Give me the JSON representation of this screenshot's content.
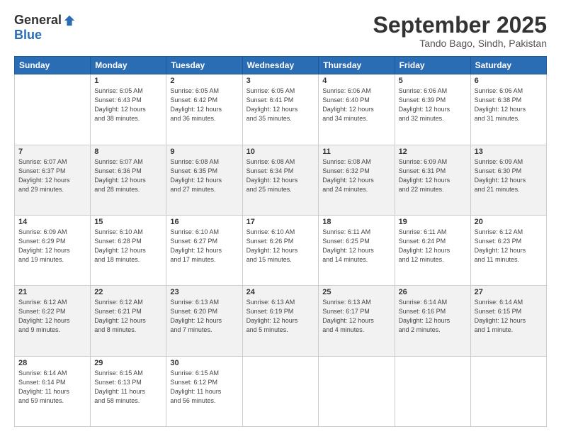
{
  "header": {
    "logo_general": "General",
    "logo_blue": "Blue",
    "month_title": "September 2025",
    "location": "Tando Bago, Sindh, Pakistan"
  },
  "columns": [
    "Sunday",
    "Monday",
    "Tuesday",
    "Wednesday",
    "Thursday",
    "Friday",
    "Saturday"
  ],
  "weeks": [
    [
      {
        "day": "",
        "info": ""
      },
      {
        "day": "1",
        "info": "Sunrise: 6:05 AM\nSunset: 6:43 PM\nDaylight: 12 hours\nand 38 minutes."
      },
      {
        "day": "2",
        "info": "Sunrise: 6:05 AM\nSunset: 6:42 PM\nDaylight: 12 hours\nand 36 minutes."
      },
      {
        "day": "3",
        "info": "Sunrise: 6:05 AM\nSunset: 6:41 PM\nDaylight: 12 hours\nand 35 minutes."
      },
      {
        "day": "4",
        "info": "Sunrise: 6:06 AM\nSunset: 6:40 PM\nDaylight: 12 hours\nand 34 minutes."
      },
      {
        "day": "5",
        "info": "Sunrise: 6:06 AM\nSunset: 6:39 PM\nDaylight: 12 hours\nand 32 minutes."
      },
      {
        "day": "6",
        "info": "Sunrise: 6:06 AM\nSunset: 6:38 PM\nDaylight: 12 hours\nand 31 minutes."
      }
    ],
    [
      {
        "day": "7",
        "info": "Sunrise: 6:07 AM\nSunset: 6:37 PM\nDaylight: 12 hours\nand 29 minutes."
      },
      {
        "day": "8",
        "info": "Sunrise: 6:07 AM\nSunset: 6:36 PM\nDaylight: 12 hours\nand 28 minutes."
      },
      {
        "day": "9",
        "info": "Sunrise: 6:08 AM\nSunset: 6:35 PM\nDaylight: 12 hours\nand 27 minutes."
      },
      {
        "day": "10",
        "info": "Sunrise: 6:08 AM\nSunset: 6:34 PM\nDaylight: 12 hours\nand 25 minutes."
      },
      {
        "day": "11",
        "info": "Sunrise: 6:08 AM\nSunset: 6:32 PM\nDaylight: 12 hours\nand 24 minutes."
      },
      {
        "day": "12",
        "info": "Sunrise: 6:09 AM\nSunset: 6:31 PM\nDaylight: 12 hours\nand 22 minutes."
      },
      {
        "day": "13",
        "info": "Sunrise: 6:09 AM\nSunset: 6:30 PM\nDaylight: 12 hours\nand 21 minutes."
      }
    ],
    [
      {
        "day": "14",
        "info": "Sunrise: 6:09 AM\nSunset: 6:29 PM\nDaylight: 12 hours\nand 19 minutes."
      },
      {
        "day": "15",
        "info": "Sunrise: 6:10 AM\nSunset: 6:28 PM\nDaylight: 12 hours\nand 18 minutes."
      },
      {
        "day": "16",
        "info": "Sunrise: 6:10 AM\nSunset: 6:27 PM\nDaylight: 12 hours\nand 17 minutes."
      },
      {
        "day": "17",
        "info": "Sunrise: 6:10 AM\nSunset: 6:26 PM\nDaylight: 12 hours\nand 15 minutes."
      },
      {
        "day": "18",
        "info": "Sunrise: 6:11 AM\nSunset: 6:25 PM\nDaylight: 12 hours\nand 14 minutes."
      },
      {
        "day": "19",
        "info": "Sunrise: 6:11 AM\nSunset: 6:24 PM\nDaylight: 12 hours\nand 12 minutes."
      },
      {
        "day": "20",
        "info": "Sunrise: 6:12 AM\nSunset: 6:23 PM\nDaylight: 12 hours\nand 11 minutes."
      }
    ],
    [
      {
        "day": "21",
        "info": "Sunrise: 6:12 AM\nSunset: 6:22 PM\nDaylight: 12 hours\nand 9 minutes."
      },
      {
        "day": "22",
        "info": "Sunrise: 6:12 AM\nSunset: 6:21 PM\nDaylight: 12 hours\nand 8 minutes."
      },
      {
        "day": "23",
        "info": "Sunrise: 6:13 AM\nSunset: 6:20 PM\nDaylight: 12 hours\nand 7 minutes."
      },
      {
        "day": "24",
        "info": "Sunrise: 6:13 AM\nSunset: 6:19 PM\nDaylight: 12 hours\nand 5 minutes."
      },
      {
        "day": "25",
        "info": "Sunrise: 6:13 AM\nSunset: 6:17 PM\nDaylight: 12 hours\nand 4 minutes."
      },
      {
        "day": "26",
        "info": "Sunrise: 6:14 AM\nSunset: 6:16 PM\nDaylight: 12 hours\nand 2 minutes."
      },
      {
        "day": "27",
        "info": "Sunrise: 6:14 AM\nSunset: 6:15 PM\nDaylight: 12 hours\nand 1 minute."
      }
    ],
    [
      {
        "day": "28",
        "info": "Sunrise: 6:14 AM\nSunset: 6:14 PM\nDaylight: 11 hours\nand 59 minutes."
      },
      {
        "day": "29",
        "info": "Sunrise: 6:15 AM\nSunset: 6:13 PM\nDaylight: 11 hours\nand 58 minutes."
      },
      {
        "day": "30",
        "info": "Sunrise: 6:15 AM\nSunset: 6:12 PM\nDaylight: 11 hours\nand 56 minutes."
      },
      {
        "day": "",
        "info": ""
      },
      {
        "day": "",
        "info": ""
      },
      {
        "day": "",
        "info": ""
      },
      {
        "day": "",
        "info": ""
      }
    ]
  ]
}
